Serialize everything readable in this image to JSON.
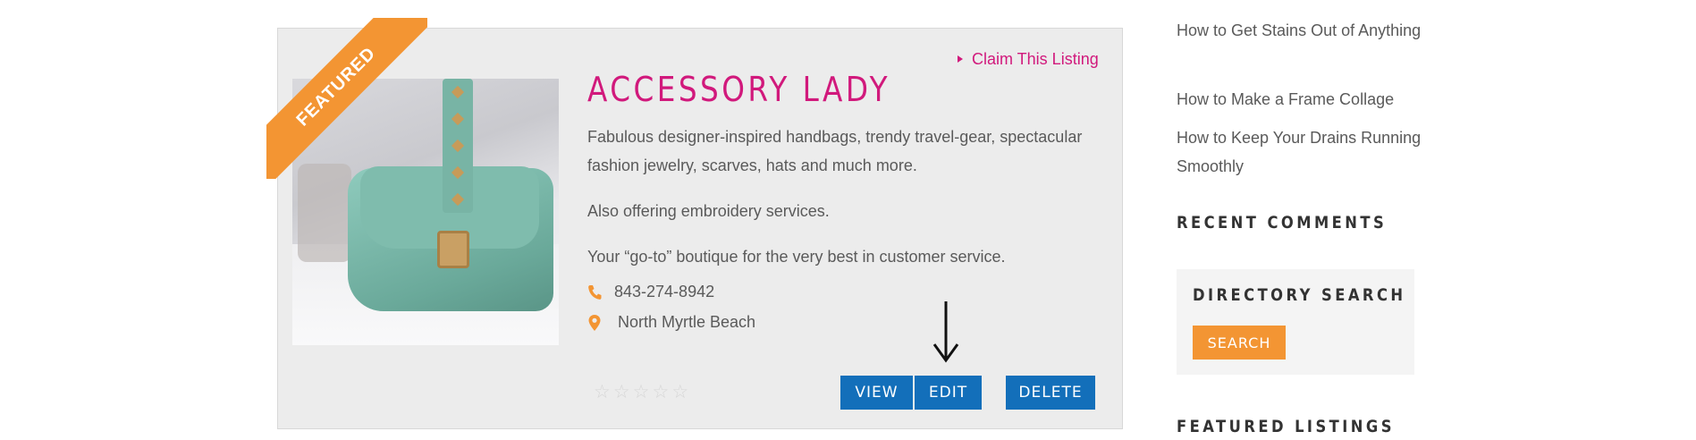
{
  "listing": {
    "featured_label": "FEATURED",
    "claim_label": "Claim This Listing",
    "title": "ACCESSORY LADY",
    "description_line1": "Fabulous designer-inspired handbags, trendy travel-gear, spectacular fashion jewelry, scarves, hats and much more.",
    "description_line2": "Also offering embroidery services.",
    "description_line3": "Your “go-to” boutique for the very best in customer service.",
    "phone": "843-274-8942",
    "location": "North Myrtle Beach",
    "rating": 0,
    "rating_max": 5,
    "buttons": {
      "view": "VIEW",
      "edit": "EDIT",
      "delete": "DELETE"
    }
  },
  "sidebar": {
    "links": [
      "How to Get Stains Out of Anything",
      "How to Make a Frame Collage",
      "How to Keep Your Drains Running Smoothly"
    ],
    "recent_comments_heading": "RECENT COMMENTS",
    "directory_search": {
      "heading": "DIRECTORY SEARCH",
      "button": "SEARCH"
    },
    "featured_listings_heading": "FEATURED LISTINGS"
  },
  "colors": {
    "accent_pink": "#d1197c",
    "button_blue": "#136fba",
    "ribbon_orange": "#f39533"
  },
  "icons": [
    "phone-icon",
    "map-pin-icon",
    "star-icon",
    "down-arrow-icon",
    "play-triangle-icon"
  ]
}
